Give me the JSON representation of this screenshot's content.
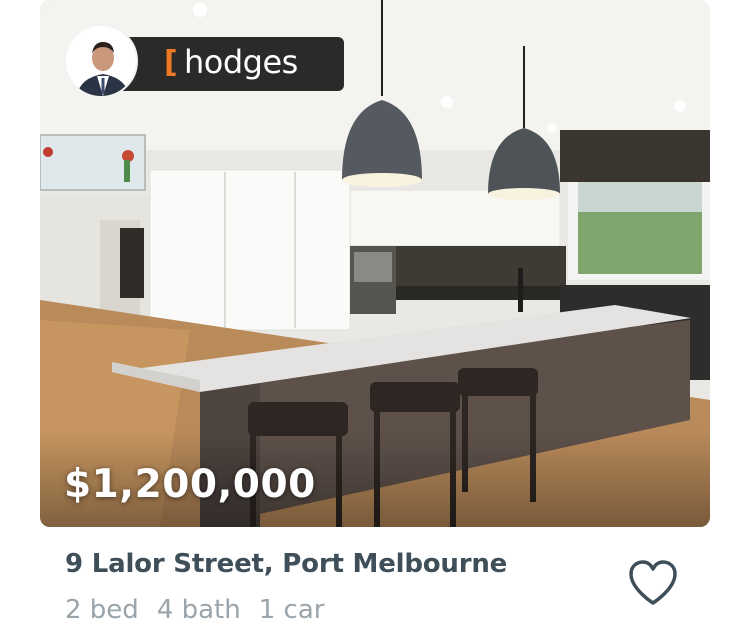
{
  "listing": {
    "price": "$1,200,000",
    "address": "9 Lalor Street, Port Melbourne",
    "features": {
      "bed": "2 bed",
      "bath": "4 bath",
      "car": "1 car"
    }
  },
  "agency": {
    "bracket": "[",
    "name": "hodges",
    "accent": "#f07a24",
    "pill_color": "#2b2a29"
  },
  "icons": {
    "favorite": "heart-outline-icon"
  },
  "colors": {
    "address": "#3f4f5a",
    "features": "#9aa4ab"
  }
}
